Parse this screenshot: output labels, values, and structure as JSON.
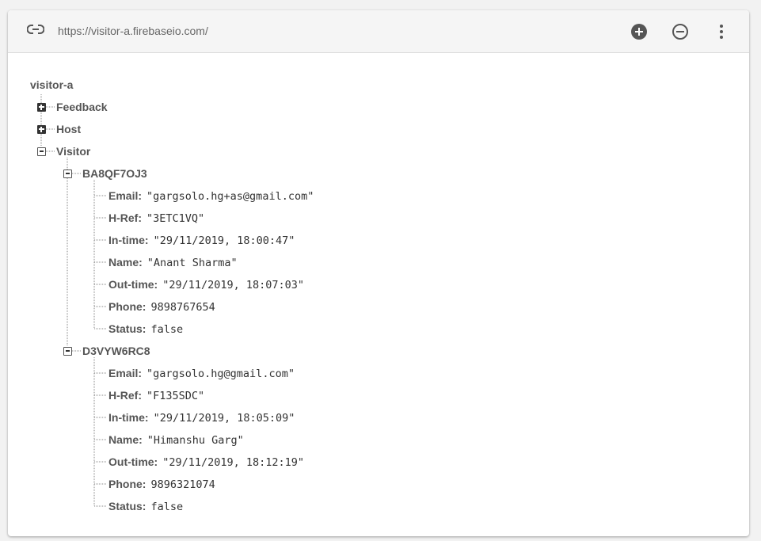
{
  "toolbar": {
    "url": "https://visitor-a.firebaseio.com/",
    "icons": [
      "link-icon",
      "add-circle-icon",
      "remove-circle-icon",
      "more-vert-icon"
    ]
  },
  "tree": {
    "root": "visitor-a",
    "top_nodes": [
      {
        "key": "Feedback",
        "state": "collapsed"
      },
      {
        "key": "Host",
        "state": "collapsed"
      },
      {
        "key": "Visitor",
        "state": "expanded"
      }
    ],
    "visitors": [
      {
        "id": "BA8QF7OJ3",
        "fields": [
          {
            "key": "Email:",
            "value": "\"gargsolo.hg+as@gmail.com\""
          },
          {
            "key": "H-Ref:",
            "value": "\"3ETC1VQ\""
          },
          {
            "key": "In-time:",
            "value": "\"29/11/2019, 18:00:47\""
          },
          {
            "key": "Name:",
            "value": "\"Anant Sharma\""
          },
          {
            "key": "Out-time:",
            "value": "\"29/11/2019, 18:07:03\""
          },
          {
            "key": "Phone:",
            "value": "9898767654"
          },
          {
            "key": "Status:",
            "value": "false"
          }
        ]
      },
      {
        "id": "D3VYW6RC8",
        "fields": [
          {
            "key": "Email:",
            "value": "\"gargsolo.hg@gmail.com\""
          },
          {
            "key": "H-Ref:",
            "value": "\"F135SDC\""
          },
          {
            "key": "In-time:",
            "value": "\"29/11/2019, 18:05:09\""
          },
          {
            "key": "Name:",
            "value": "\"Himanshu Garg\""
          },
          {
            "key": "Out-time:",
            "value": "\"29/11/2019, 18:12:19\""
          },
          {
            "key": "Phone:",
            "value": "9896321074"
          },
          {
            "key": "Status:",
            "value": "false"
          }
        ]
      }
    ]
  }
}
